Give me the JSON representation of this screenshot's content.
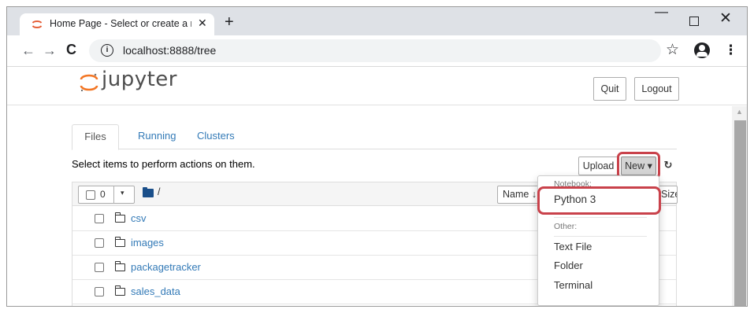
{
  "browser": {
    "tab_title": "Home Page - Select or create a n",
    "tab_close": "✕",
    "new_tab": "+",
    "window_minimize": "—",
    "window_close": "✕",
    "url": "localhost:8888/tree",
    "info_glyph": "i",
    "back_glyph": "←",
    "forward_glyph": "→",
    "reload_glyph": "C",
    "star_glyph": "☆",
    "menu_glyph": "⋮"
  },
  "header": {
    "logo_text": "jupyter",
    "quit_label": "Quit",
    "logout_label": "Logout",
    "logo_color": "#f37726"
  },
  "tabs": [
    {
      "label": "Files",
      "active": true
    },
    {
      "label": "Running",
      "active": false
    },
    {
      "label": "Clusters",
      "active": false
    }
  ],
  "toolbar": {
    "instruction": "Select items to perform actions on them.",
    "upload_label": "Upload",
    "new_label": "New ▾",
    "refresh_glyph": "↻"
  },
  "list_header": {
    "selected_count": "0",
    "caret": "▾",
    "breadcrumb": "/",
    "name_sort_label": "Name ↓",
    "right_button_label": "Size"
  },
  "rows": [
    {
      "name": "csv",
      "type": "folder"
    },
    {
      "name": "images",
      "type": "folder"
    },
    {
      "name": "packagetracker",
      "type": "folder"
    },
    {
      "name": "sales_data",
      "type": "folder"
    }
  ],
  "new_menu": {
    "notebook_header": "Notebook:",
    "python_label": "Python 3",
    "other_header": "Other:",
    "items": [
      "Text File",
      "Folder",
      "Terminal"
    ]
  },
  "highlight_color": "#c9424b"
}
